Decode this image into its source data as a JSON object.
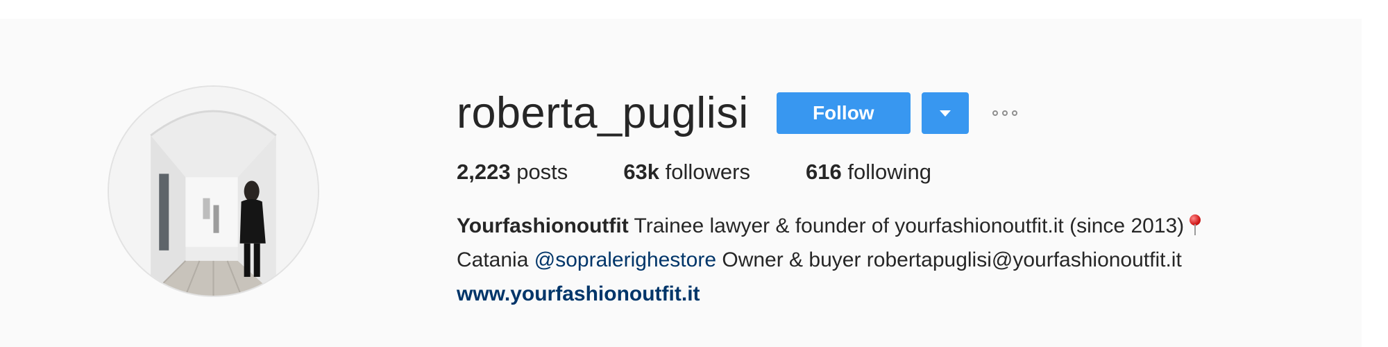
{
  "profile": {
    "username": "roberta_puglisi",
    "follow_label": "Follow",
    "dropdown_icon": "caret-down-icon",
    "more_icon": "more-options-icon"
  },
  "stats": {
    "posts_count": "2,223",
    "posts_label": "posts",
    "followers_count": "63k",
    "followers_label": "followers",
    "following_count": "616",
    "following_label": "following"
  },
  "bio": {
    "name": "Yourfashionoutfit",
    "text_1": "Trainee lawyer & founder of yourfashionoutfit.it (since 2013)",
    "pin_icon": "round-pushpin-icon",
    "text_2": "Catania",
    "mention": "@sopralerighestore",
    "text_3": "Owner & buyer robertapuglisi@yourfashionoutfit.it",
    "website": "www.yourfashionoutfit.it"
  },
  "colors": {
    "follow_button": "#3897f0",
    "link": "#003569",
    "text": "#262626",
    "panel_background": "#fafafa"
  }
}
